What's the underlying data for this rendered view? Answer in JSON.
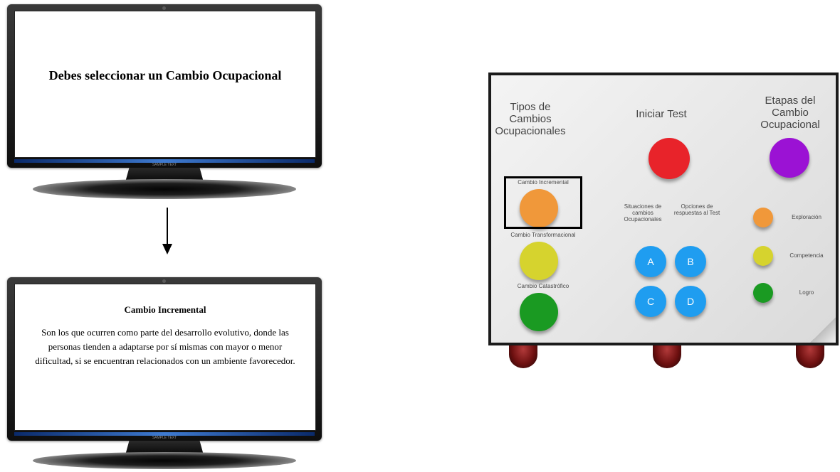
{
  "monitor_top": {
    "title": "Debes seleccionar un Cambio Ocupacional",
    "brand": "SAMPLE TEXT"
  },
  "monitor_bottom": {
    "title": "Cambio Incremental",
    "body": "Son los que ocurren como parte del desarrollo evolutivo, donde las personas tienden a adaptarse por sí mismas con mayor o menor dificultad, si se encuentran relacionados con un ambiente favorecedor.",
    "brand": "SAMPLE TEXT"
  },
  "device": {
    "tipos_heading": "Tipos de Cambios Ocupacionales",
    "iniciar_heading": "Iniciar Test",
    "etapas_heading": "Etapas del Cambio Ocupacional",
    "cambios": [
      {
        "label": "Cambio Incremental",
        "color": "#f0983a"
      },
      {
        "label": "Cambio Transformacional",
        "color": "#d6d32e"
      },
      {
        "label": "Cambio Catastrófico",
        "color": "#1a9a22"
      }
    ],
    "situaciones_label": "Situaciones de cambios Ocupacionales",
    "opciones_label": "Opciones de respuestas al Test",
    "options": [
      "A",
      "B",
      "C",
      "D"
    ],
    "etapas": [
      {
        "label": "Exploración",
        "color": "#f0983a"
      },
      {
        "label": "Competencia",
        "color": "#d6d32e"
      },
      {
        "label": "Logro",
        "color": "#1a9a22"
      }
    ],
    "start_color": "#e8232a",
    "etapas_color": "#9b12d4",
    "option_color": "#1f9df0"
  }
}
